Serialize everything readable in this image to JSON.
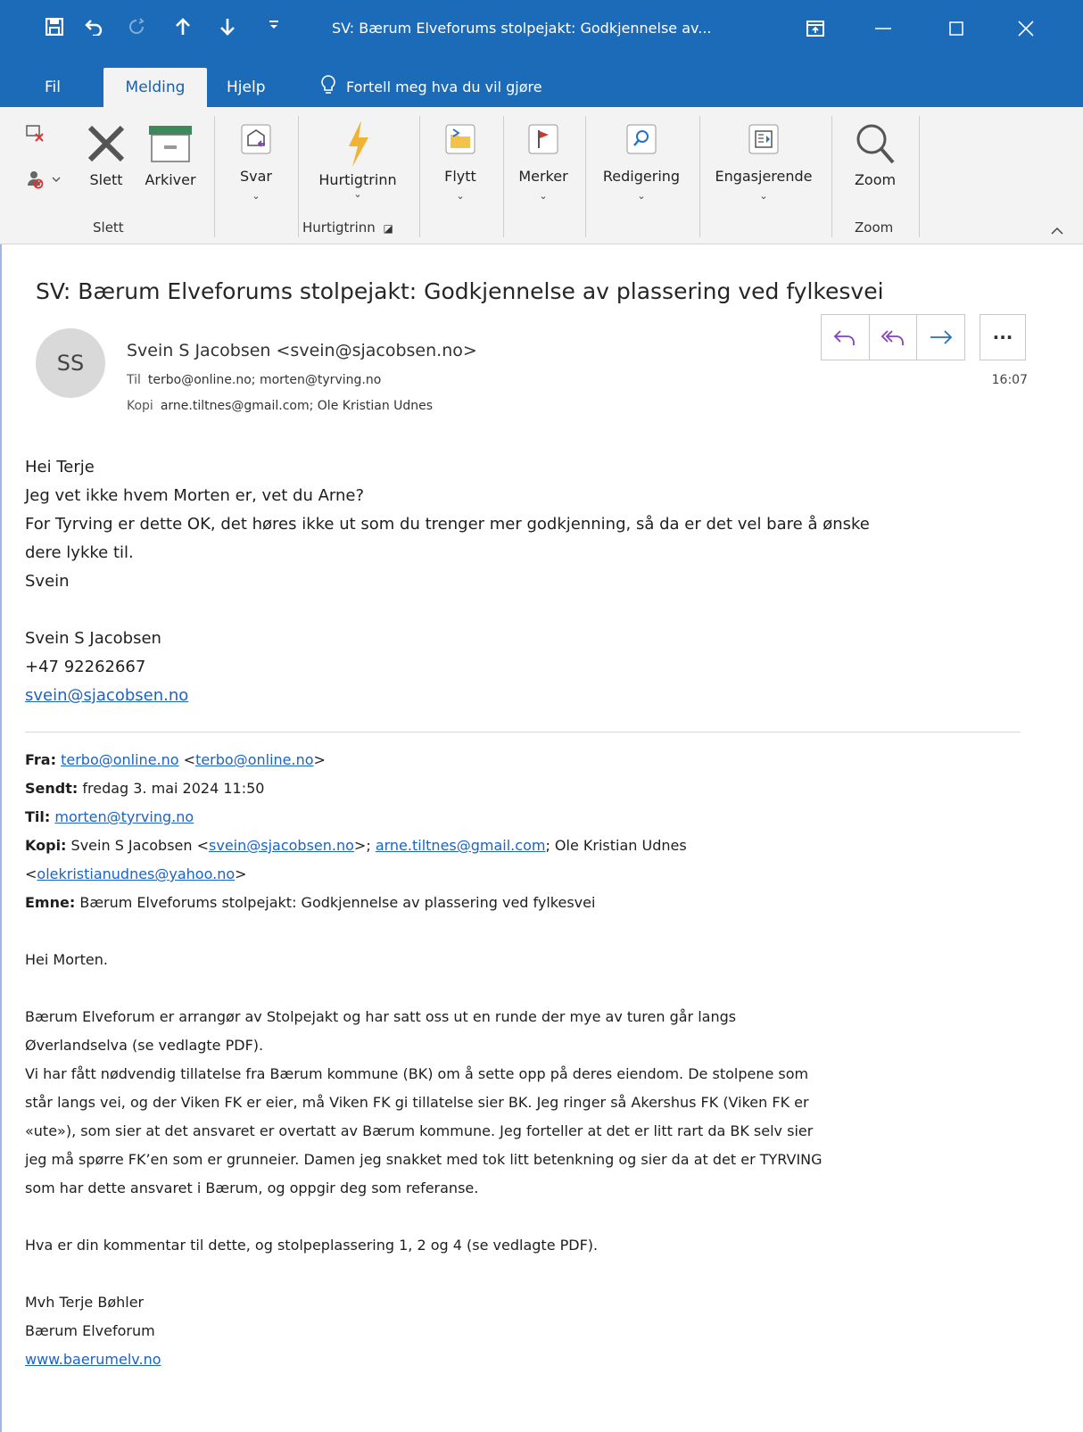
{
  "titlebar": {
    "window_title": "SV: Bærum Elveforums stolpejakt: Godkjennelse av...",
    "qa_save_icon": "save-icon",
    "qa_undo_icon": "undo-icon",
    "qa_redo_icon": "redo-icon",
    "qa_up_icon": "up-arrow-icon",
    "qa_down_icon": "down-arrow-icon",
    "qa_custom_icon": "customize-icon"
  },
  "tabs": {
    "fil": "Fil",
    "melding": "Melding",
    "hjelp": "Hjelp",
    "tellme": "Fortell meg hva du vil gjøre"
  },
  "ribbon": {
    "slett": "Slett",
    "arkiver": "Arkiver",
    "svar": "Svar",
    "hurtigtrinn": "Hurtigtrinn",
    "flytt": "Flytt",
    "merker": "Merker",
    "redigering": "Redigering",
    "engasjerende": "Engasjerende",
    "zoom": "Zoom",
    "group_slett": "Slett",
    "group_hurtigtrinn": "Hurtigtrinn",
    "group_zoom": "Zoom",
    "accent": "#1c6bb8"
  },
  "message": {
    "subject": "SV: Bærum Elveforums stolpejakt: Godkjennelse av plassering ved fylkesvei",
    "avatar_initials": "SS",
    "sender": "Svein S Jacobsen <svein@sjacobsen.no>",
    "to_label": "Til",
    "to": "terbo@online.no; morten@tyrving.no",
    "cc_label": "Kopi",
    "cc": "arne.tiltnes@gmail.com; Ole Kristian Udnes",
    "time": "16:07"
  },
  "body": {
    "l1": "Hei Terje",
    "l2": "Jeg vet ikke hvem Morten er, vet du Arne?",
    "l3": "For Tyrving er dette OK, det høres ikke ut som du trenger mer godkjenning, så da er det vel bare å ønske",
    "l4": "dere lykke til.",
    "l5": "Svein",
    "sig_name": "Svein S Jacobsen",
    "sig_phone": "+47 92262667",
    "sig_email": "svein@sjacobsen.no"
  },
  "forward": {
    "fra_label": "Fra:",
    "fra_link": "terbo@online.no",
    "fra_lt": "<",
    "fra_link2": "terbo@online.no",
    "fra_gt": ">",
    "sendt_label": "Sendt:",
    "sendt": "fredag 3. mai 2024 11:50",
    "til_label": "Til:",
    "til_link": "morten@tyrving.no",
    "kopi_label": "Kopi:",
    "kopi_a": "Svein S Jacobsen <",
    "kopi_link1": "svein@sjacobsen.no",
    "kopi_b": ">; ",
    "kopi_link2": "arne.tiltnes@gmail.com",
    "kopi_c": "; Ole Kristian Udnes",
    "kopi_lt": "<",
    "kopi_link3": "olekristianudnes@yahoo.no",
    "kopi_gt": ">",
    "emne_label": "Emne:",
    "emne": "Bærum Elveforums stolpejakt: Godkjennelse av plassering ved fylkesvei",
    "p_greet": "Hei Morten.",
    "p1a": "Bærum Elveforum er arrangør av Stolpejakt og har satt oss ut en runde der mye av turen går langs",
    "p1b": "Øverlandselva (se vedlagte PDF).",
    "p2a": "Vi har fått nødvendig tillatelse fra Bærum kommune (BK) om å sette opp på deres eiendom. De stolpene som",
    "p2b": "står langs vei, og der Viken FK er eier, må Viken FK gi tillatelse sier BK. Jeg ringer så Akershus FK (Viken FK er",
    "p2c": "«ute»), som sier at det ansvaret er overtatt av Bærum kommune. Jeg forteller at det er litt rart da BK selv sier",
    "p2d": "jeg må spørre FK’en som er grunneier. Damen jeg snakket med tok litt betenkning og sier da at det er TYRVING",
    "p2e": "som har dette ansvaret i Bærum, og oppgir deg som referanse.",
    "p3": "Hva er din kommentar til dette, og stolpeplassering 1, 2 og 4 (se vedlagte PDF).",
    "s1": "Mvh Terje Bøhler",
    "s2": "Bærum Elveforum",
    "s3": "www.baerumelv.no"
  }
}
